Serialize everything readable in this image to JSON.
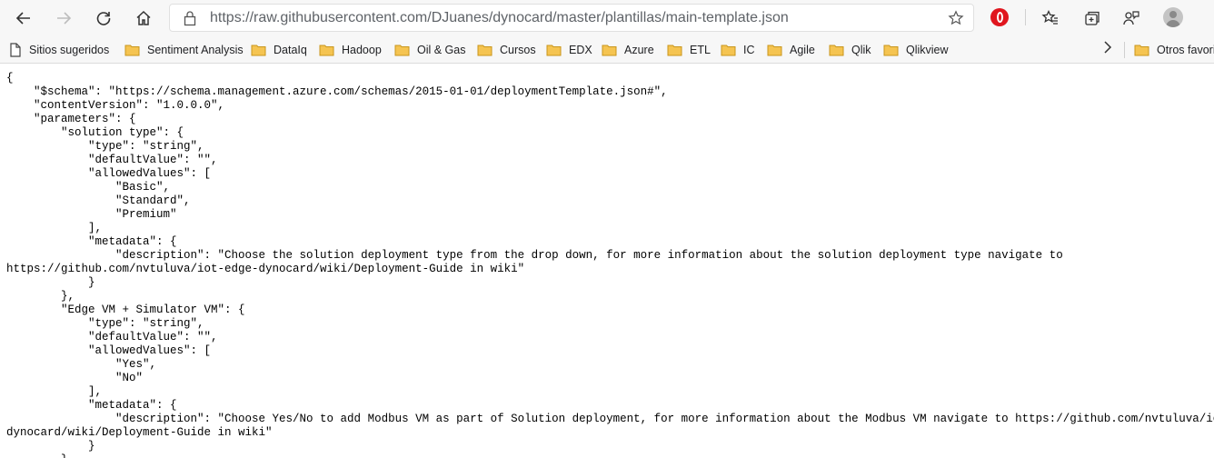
{
  "browser": {
    "url": "https://raw.githubusercontent.com/DJuanes/dynocard/master/plantillas/main-template.json",
    "icons": [
      "back-icon",
      "forward-icon",
      "refresh-icon",
      "home-icon",
      "lock-icon",
      "star-icon",
      "opera-icon",
      "favorites-icon",
      "collections-icon",
      "feedback-icon",
      "avatar-icon"
    ]
  },
  "bookmarks": [
    {
      "label": "Sitios sugeridos",
      "icon": "page-icon"
    },
    {
      "label": "Sentiment Analysis",
      "icon": "folder-icon"
    },
    {
      "label": "DataIq",
      "icon": "folder-icon"
    },
    {
      "label": "Hadoop",
      "icon": "folder-icon"
    },
    {
      "label": "Oil & Gas",
      "icon": "folder-icon"
    },
    {
      "label": "Cursos",
      "icon": "folder-icon"
    },
    {
      "label": "EDX",
      "icon": "folder-icon"
    },
    {
      "label": "Azure",
      "icon": "folder-icon"
    },
    {
      "label": "ETL",
      "icon": "folder-icon"
    },
    {
      "label": "IC",
      "icon": "folder-icon"
    },
    {
      "label": "Agile",
      "icon": "folder-icon"
    },
    {
      "label": "Qlik",
      "icon": "folder-icon"
    },
    {
      "label": "Qlikview",
      "icon": "folder-icon"
    }
  ],
  "other_favorites": "Otros favoritos",
  "content": {
    "lines": [
      "{",
      "    \"$schema\": \"https://schema.management.azure.com/schemas/2015-01-01/deploymentTemplate.json#\",",
      "    \"contentVersion\": \"1.0.0.0\",",
      "    \"parameters\": {",
      "        \"solution type\": {",
      "            \"type\": \"string\",",
      "            \"defaultValue\": \"\",",
      "            \"allowedValues\": [",
      "                \"Basic\",",
      "                \"Standard\",",
      "                \"Premium\"",
      "            ],",
      "            \"metadata\": {",
      "                \"description\": \"Choose the solution deployment type from the drop down, for more information about the solution deployment type navigate to",
      "https://github.com/nvtuluva/iot-edge-dynocard/wiki/Deployment-Guide in wiki\"",
      "            }",
      "        },",
      "        \"Edge VM + Simulator VM\": {",
      "            \"type\": \"string\",",
      "            \"defaultValue\": \"\",",
      "            \"allowedValues\": [",
      "                \"Yes\",",
      "                \"No\"",
      "            ],",
      "            \"metadata\": {",
      "                \"description\": \"Choose Yes/No to add Modbus VM as part of Solution deployment, for more information about the Modbus VM navigate to https://github.com/nvtuluva/iot-edge-",
      "dynocard/wiki/Deployment-Guide in wiki\"",
      "            }",
      "        },"
    ]
  }
}
